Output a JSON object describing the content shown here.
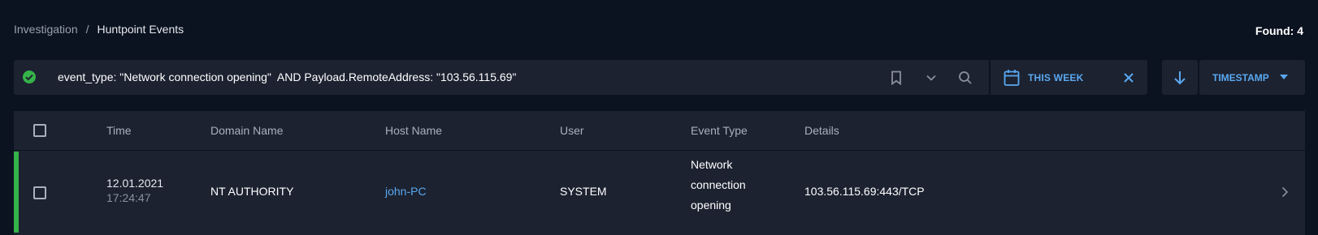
{
  "breadcrumb": {
    "parent": "Investigation",
    "separator": "/",
    "current": "Huntpoint Events"
  },
  "found": {
    "label": "Found:",
    "count": "4"
  },
  "search": {
    "query": "event_type: \"Network connection opening\"  AND Payload.RemoteAddress: \"103.56.115.69\"",
    "status_icon": "check-circle-icon",
    "icons": [
      "bookmark-icon",
      "chevron-down-icon",
      "search-icon"
    ],
    "period_label": "THIS WEEK",
    "period_icon": "calendar-icon",
    "clear_icon": "close-icon"
  },
  "sort": {
    "direction_icon": "arrow-down-icon",
    "field_label": "TIMESTAMP",
    "caret_icon": "caret-down-icon"
  },
  "table": {
    "columns": [
      "Time",
      "Domain Name",
      "Host Name",
      "User",
      "Event Type",
      "Details"
    ],
    "rows": [
      {
        "date": "12.01.2021",
        "time": "17:24:47",
        "domain": "NT AUTHORITY",
        "host": "john-PC",
        "user": "SYSTEM",
        "event_type_lines": [
          "Network",
          "connection",
          "opening"
        ],
        "details": "103.56.115.69:443/TCP",
        "status_color": "#35b24a"
      }
    ]
  },
  "colors": {
    "background": "#0b1220",
    "panel": "#1c2230",
    "accent": "#5aa8f0",
    "success": "#35b24a"
  }
}
